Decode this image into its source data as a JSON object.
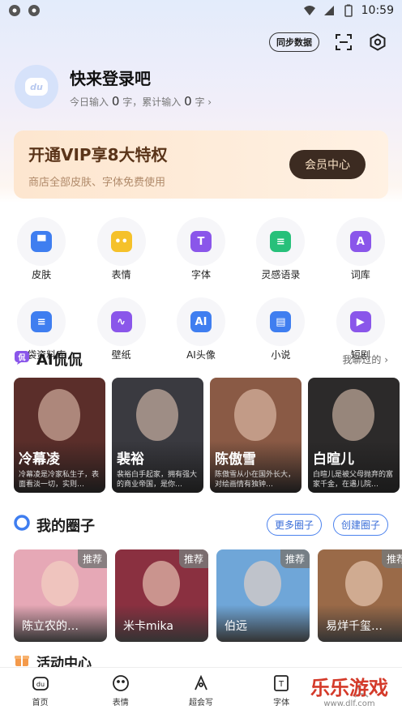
{
  "status": {
    "time": "10:59"
  },
  "top": {
    "sync": "同步数据"
  },
  "profile": {
    "login": "快来登录吧",
    "today_prefix": "今日输入",
    "today_count": "0",
    "today_unit": "字，累计输入",
    "total_count": "0",
    "total_unit": "字 ›",
    "avatar_text": "du"
  },
  "vip": {
    "title": "开通VIP享8大特权",
    "subtitle": "商店全部皮肤、字体免费使用",
    "button": "会员中心"
  },
  "grid": [
    [
      {
        "label": "皮肤",
        "icon": "shirt-icon",
        "color": "#3f7ef0",
        "glyph": "▀"
      },
      {
        "label": "表情",
        "icon": "smiley-icon",
        "color": "#f5c12a",
        "glyph": "••"
      },
      {
        "label": "字体",
        "icon": "font-icon",
        "color": "#8a56ea",
        "glyph": "T"
      },
      {
        "label": "灵感语录",
        "icon": "chat-sparkle-icon",
        "color": "#27c07a",
        "glyph": "≡"
      },
      {
        "label": "词库",
        "icon": "dictionary-icon",
        "color": "#8a56ea",
        "glyph": "A"
      }
    ],
    [
      {
        "label": "口袋资料库",
        "icon": "document-icon",
        "color": "#3f7ef0",
        "glyph": "≡"
      },
      {
        "label": "壁纸",
        "icon": "wallpaper-icon",
        "color": "#8a56ea",
        "glyph": "∿"
      },
      {
        "label": "AI头像",
        "icon": "ai-avatar-icon",
        "color": "#3f7ef0",
        "glyph": "AI"
      },
      {
        "label": "小说",
        "icon": "book-icon",
        "color": "#3f7ef0",
        "glyph": "▤"
      },
      {
        "label": "短剧",
        "icon": "play-icon",
        "color": "#8a56ea",
        "glyph": "▶"
      }
    ]
  ],
  "ai": {
    "title": "AI侃侃",
    "more": "我聊过的 ›",
    "cards": [
      {
        "name": "冷幕凌",
        "desc": "冷幕凌是冷家私生子，表面看淡一切，实则…",
        "bg": "#5b2e2a"
      },
      {
        "name": "裴裕",
        "desc": "裴裕白手起家，拥有强大的商业帝国，是你…",
        "bg": "#3a3a40"
      },
      {
        "name": "陈傲雪",
        "desc": "陈傲雪从小在国外长大，对绘画情有独钟…",
        "bg": "#8a5a45"
      },
      {
        "name": "白暄儿",
        "desc": "白暄儿是被父母抛弃的富家千金，在遇儿院…",
        "bg": "#2c2a2a"
      }
    ]
  },
  "circles": {
    "title": "我的圈子",
    "more": "更多圈子",
    "create": "创建圈子",
    "items": [
      {
        "name": "陈立农的…",
        "tag": "推荐",
        "bg": "#e6a8b6"
      },
      {
        "name": "米卡mika",
        "tag": "推荐",
        "bg": "#8a3040"
      },
      {
        "name": "伯远",
        "tag": "推荐",
        "bg": "#6fa6d8"
      },
      {
        "name": "易烊千玺…",
        "tag": "推荐",
        "bg": "#9a6a48"
      }
    ]
  },
  "activity": {
    "title": "活动中心"
  },
  "tabs": [
    {
      "label": "首页",
      "icon": "home-icon"
    },
    {
      "label": "表情",
      "icon": "emoji-icon"
    },
    {
      "label": "超会写",
      "icon": "write-icon"
    },
    {
      "label": "字体",
      "icon": "font-tab-icon"
    },
    {
      "label": "",
      "icon": "profile-icon"
    }
  ],
  "watermark": {
    "text": "乐乐游戏",
    "sub": "www.dlf.com"
  }
}
